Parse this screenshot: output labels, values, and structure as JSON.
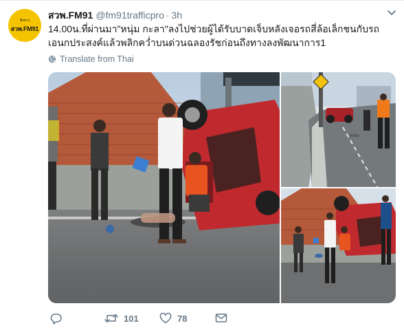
{
  "tweet": {
    "avatar": {
      "top_text": "ฟังทาง",
      "main_text": "สวพ.FM91"
    },
    "display_name": "สวพ.FM91",
    "handle": "@fm91trafficpro",
    "separator": "·",
    "time": "3h",
    "text_lines": [
      "14.00น.ที่ผ่านมา\"หนุ่ม กะลา\"ลงไปช่วยผู้ได้รับบาดเจ็บหลังเจอรถสี่ล้อเล็กชนกับรถ",
      "เอนกประสงค์แล้วพลิกคว่ำบนด่วนฉลองรัชก่อนถึงทางลงพัฒนาการ1"
    ],
    "translate_label": "Translate from Thai",
    "actions": {
      "reply_count": "",
      "retweet_count": "101",
      "like_count": "78"
    },
    "icons": [
      "chevron-down-icon",
      "globe-icon",
      "reply-icon",
      "retweet-icon",
      "like-icon",
      "direct-message-icon"
    ],
    "colors": {
      "secondary_text": "#657786",
      "primary_text": "#14171a",
      "avatar_bg": "#f5c400"
    }
  }
}
